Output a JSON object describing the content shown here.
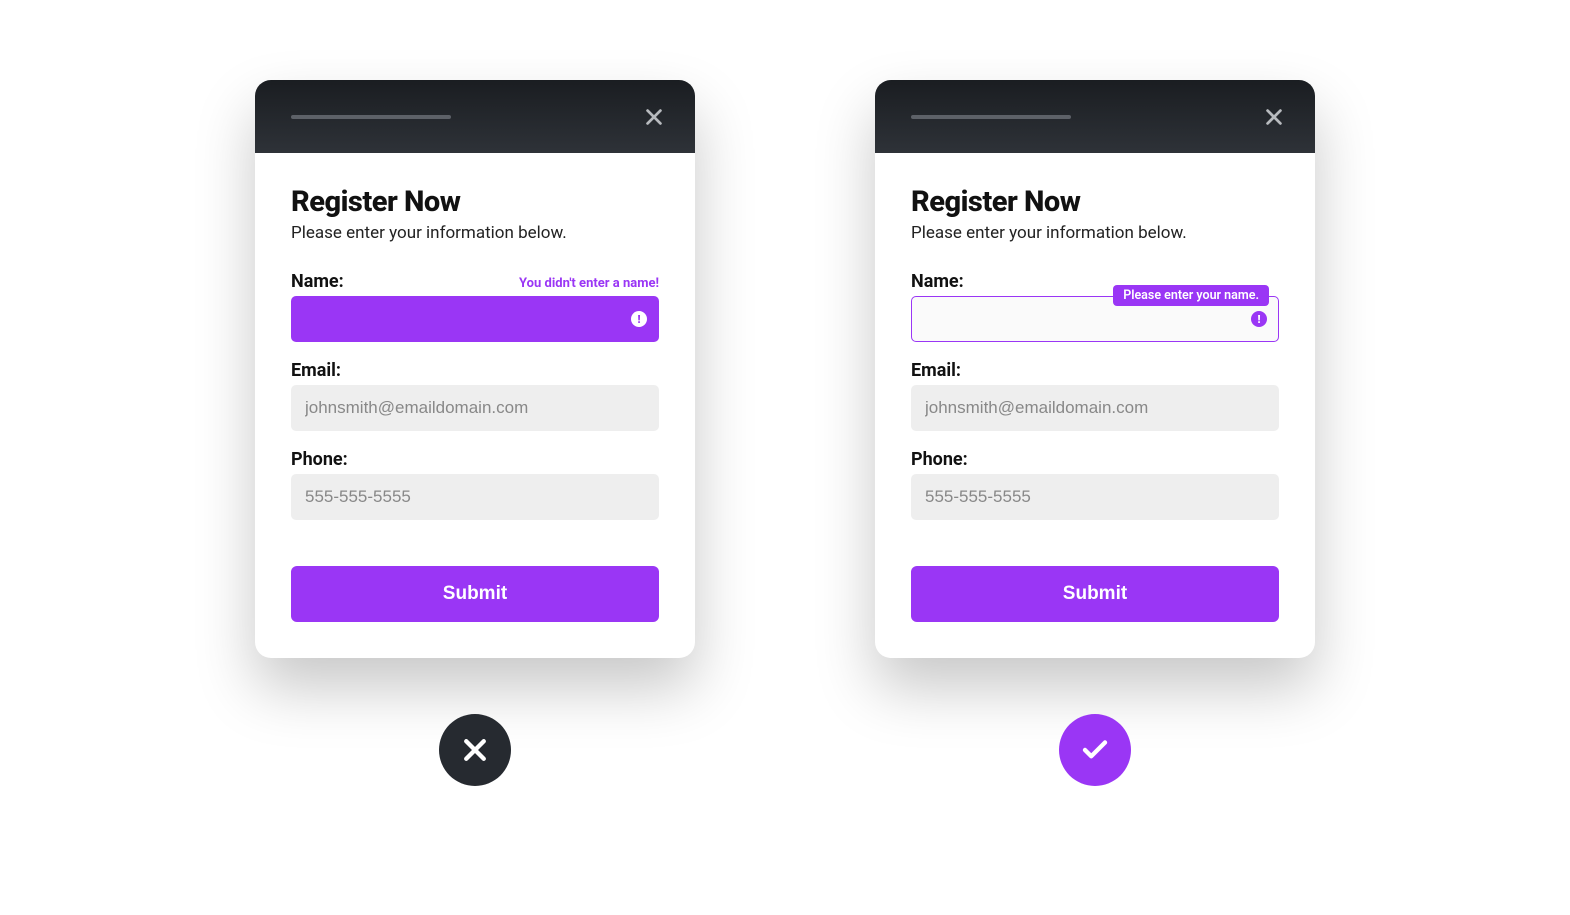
{
  "colors": {
    "accent": "#9a36f5",
    "header": "#262a30"
  },
  "bad": {
    "title": "Register Now",
    "subtitle": "Please enter your information below.",
    "name_label": "Name:",
    "name_error": "You didn't enter a name!",
    "name_value": "",
    "email_label": "Email:",
    "email_placeholder": "johnsmith@emaildomain.com",
    "phone_label": "Phone:",
    "phone_placeholder": "555-555-5555",
    "submit_label": "Submit"
  },
  "good": {
    "title": "Register Now",
    "subtitle": "Please enter your information below.",
    "name_label": "Name:",
    "name_error": "Please enter your name.",
    "name_value": "",
    "email_label": "Email:",
    "email_placeholder": "johnsmith@emaildomain.com",
    "phone_label": "Phone:",
    "phone_placeholder": "555-555-5555",
    "submit_label": "Submit"
  }
}
